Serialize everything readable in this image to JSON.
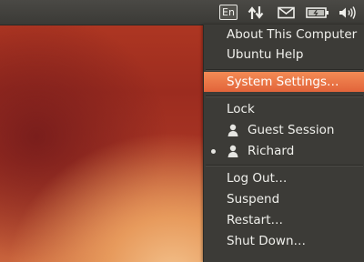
{
  "panel": {
    "keyboard_layout": "En",
    "indicators": [
      "network-arrows-icon",
      "mail-envelope-icon",
      "battery-icon",
      "volume-icon"
    ]
  },
  "session_menu": {
    "items": {
      "about": "About This Computer",
      "help": "Ubuntu Help",
      "settings": "System Settings…",
      "lock": "Lock",
      "guest": "Guest Session",
      "user": "Richard",
      "logout": "Log Out…",
      "suspend": "Suspend",
      "restart": "Restart…",
      "shutdown": "Shut Down…"
    },
    "highlighted": "settings",
    "active_user": "Richard"
  },
  "colors": {
    "panel": "#3c3b37",
    "highlight": "#e9703f",
    "menu_text": "#f0f0ec"
  }
}
